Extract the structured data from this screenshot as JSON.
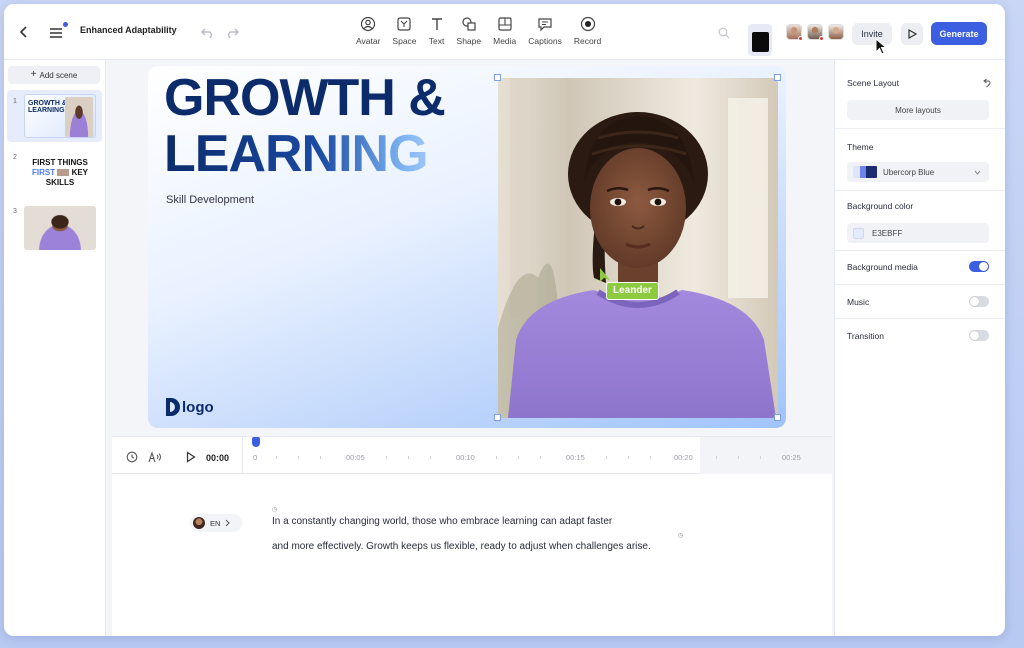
{
  "header": {
    "project_title": "Enhanced Adaptability",
    "tools": [
      {
        "label": "Avatar",
        "icon": "avatar-icon"
      },
      {
        "label": "Space",
        "icon": "space-icon"
      },
      {
        "label": "Text",
        "icon": "text-icon"
      },
      {
        "label": "Shape",
        "icon": "shape-icon"
      },
      {
        "label": "Media",
        "icon": "media-icon"
      },
      {
        "label": "Captions",
        "icon": "captions-icon"
      },
      {
        "label": "Record",
        "icon": "record-icon"
      }
    ],
    "invite_label": "Invite",
    "generate_label": "Generate"
  },
  "scenes": {
    "add_label": "Add scene",
    "items": [
      {
        "number": "1",
        "title_line1": "GROWTH &",
        "title_line2": "LEARNING"
      },
      {
        "number": "2",
        "line1": "FIRST THINGS",
        "line2a": "FIRST",
        "line2b": "KEY",
        "line3": "SKILLS"
      },
      {
        "number": "3"
      }
    ]
  },
  "canvas": {
    "headline_line1": "GROWTH &",
    "headline_line2": "LEARNING",
    "subtitle": "Skill Development",
    "logo_text": "logo",
    "avatar_tag": "Leander"
  },
  "properties": {
    "scene_layout_label": "Scene Layout",
    "more_layouts_label": "More layouts",
    "theme_label": "Theme",
    "theme_value": "Ubercorp Blue",
    "background_color_label": "Background color",
    "background_color_value": "E3EBFF",
    "background_media_label": "Background media",
    "background_media_on": true,
    "music_label": "Music",
    "music_on": false,
    "transition_label": "Transition",
    "transition_on": false
  },
  "timeline": {
    "current_time": "00:00",
    "ticks": [
      "0",
      "00:05",
      "00:10",
      "00:15",
      "00:20",
      "00:25"
    ]
  },
  "script": {
    "language": "EN",
    "line1": "In a constantly changing world, those who embrace learning can adapt faster",
    "line2": "and more effectively. Growth keeps us flexible, ready to adjust when challenges arise."
  },
  "colors": {
    "accent": "#3B5FE0",
    "headline": "#0B2B6B",
    "avatar_tag": "#8CCB3F",
    "canvas_bg": "#E3EBFF"
  }
}
